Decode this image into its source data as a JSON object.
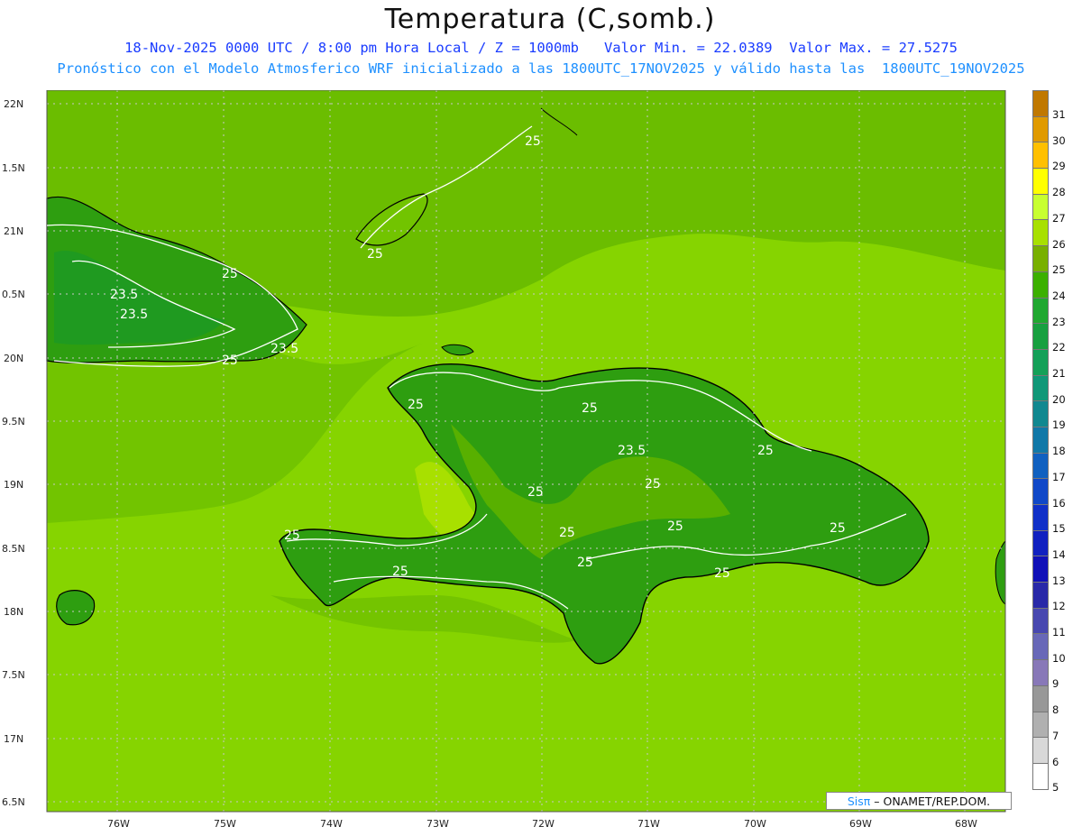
{
  "header": {
    "title": "Temperatura (C,somb.)",
    "line1": "18-Nov-2025 0000 UTC / 8:00 pm Hora Local / Z = 1000mb   Valor Min. = 22.0389  Valor Max. = 27.5275",
    "line2": "Pronóstico con el Modelo Atmosferico WRF inicializado a las 1800UTC_17NOV2025 y válido hasta las  1800UTC_19NOV2025"
  },
  "lat_labels": [
    "22N",
    "1.5N",
    "21N",
    "0.5N",
    "20N",
    "9.5N",
    "19N",
    "8.5N",
    "18N",
    "7.5N",
    "17N",
    "6.5N"
  ],
  "lon_labels": [
    "76W",
    "75W",
    "74W",
    "73W",
    "72W",
    "71W",
    "70W",
    "69W",
    "68W"
  ],
  "contour_labels": [
    "25",
    "25",
    "25",
    "23.5",
    "23.5",
    "25",
    "23.5",
    "25",
    "25",
    "23.5",
    "25",
    "25",
    "25",
    "25",
    "25",
    "25",
    "25",
    "25",
    "25",
    "25"
  ],
  "colorbar": {
    "levels": [
      "31",
      "30",
      "29",
      "28",
      "27",
      "26",
      "25",
      "24",
      "23",
      "22",
      "21",
      "20",
      "19",
      "18",
      "17",
      "16",
      "15",
      "14",
      "13",
      "12",
      "11",
      "10",
      "9",
      "8",
      "7",
      "6",
      "5"
    ],
    "colors": [
      "#c07800",
      "#e09a00",
      "#ffc000",
      "#ffff00",
      "#c8ff30",
      "#a8e000",
      "#78b000",
      "#3cb000",
      "#20a830",
      "#18a040",
      "#14a058",
      "#109878",
      "#108890",
      "#1078a8",
      "#1060c0",
      "#1048c8",
      "#1030c8",
      "#1020c0",
      "#1010b8",
      "#2828a8",
      "#4848b0",
      "#6868b8",
      "#8878b8",
      "#989898",
      "#b0b0b0",
      "#d8d8d8",
      "#ffffff"
    ]
  },
  "credit": {
    "sis": "Sisπ",
    "rest": "– ONAMET/REP.DOM."
  }
}
